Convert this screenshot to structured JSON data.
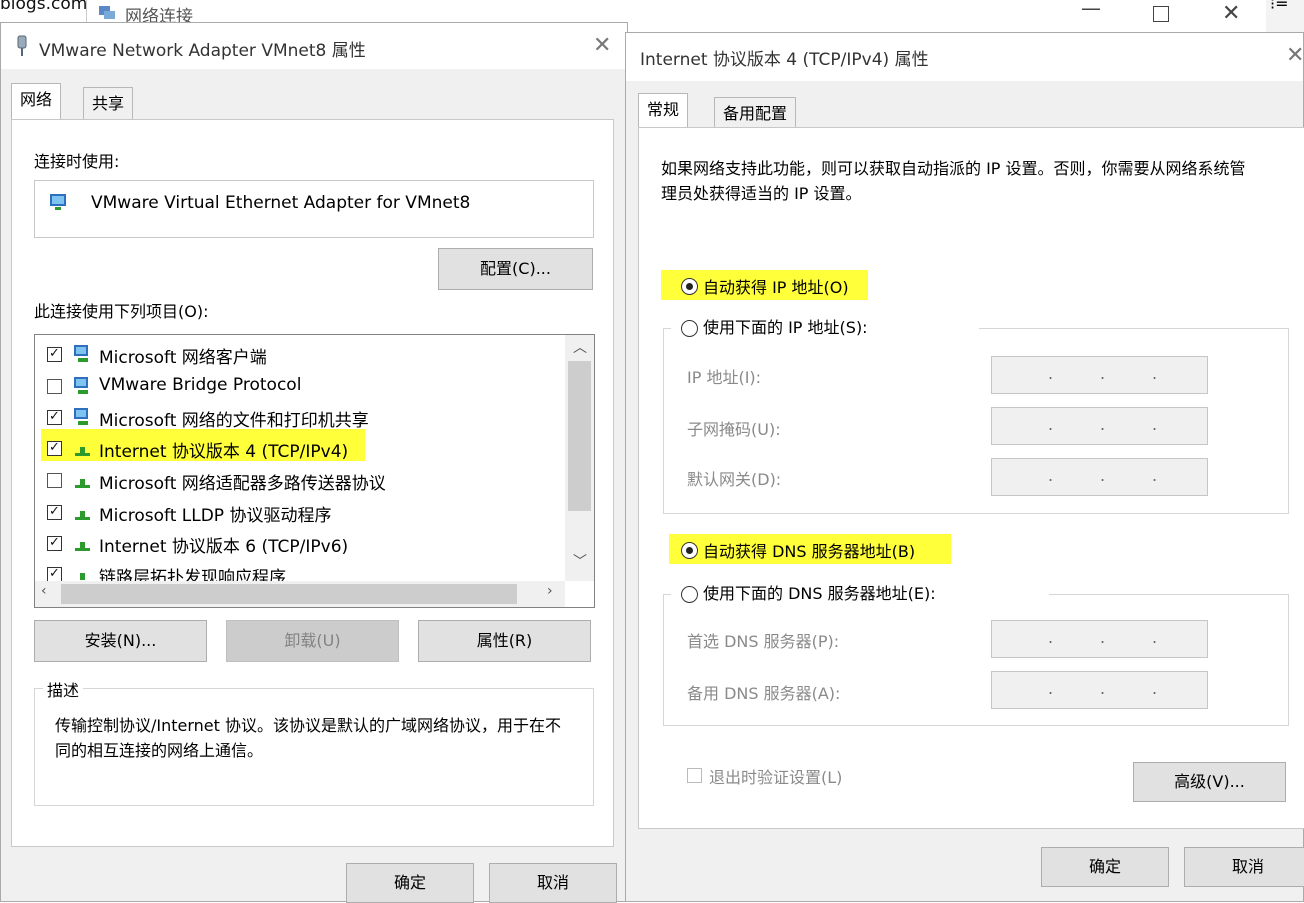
{
  "background": {
    "url_fragment": "blogs.com",
    "network_connections_title": "网络连接",
    "right_glyph": "⁝="
  },
  "adapter_dialog": {
    "title": "VMware Network Adapter VMnet8 属性",
    "tabs": [
      "网络",
      "共享"
    ],
    "connect_using_label": "连接时使用:",
    "adapter_name": "VMware Virtual Ethernet Adapter for VMnet8",
    "configure_button": "配置(C)...",
    "items_label": "此连接使用下列项目(O):",
    "items": [
      {
        "label": "Microsoft 网络客户端",
        "checked": true,
        "icon": "network-client-icon"
      },
      {
        "label": "VMware Bridge Protocol",
        "checked": false,
        "icon": "network-client-icon"
      },
      {
        "label": "Microsoft 网络的文件和打印机共享",
        "checked": true,
        "icon": "network-client-icon"
      },
      {
        "label": "Internet 协议版本 4 (TCP/IPv4)",
        "checked": true,
        "icon": "protocol-icon",
        "highlighted": true
      },
      {
        "label": "Microsoft 网络适配器多路传送器协议",
        "checked": false,
        "icon": "protocol-icon"
      },
      {
        "label": "Microsoft LLDP 协议驱动程序",
        "checked": true,
        "icon": "protocol-icon"
      },
      {
        "label": "Internet 协议版本 6 (TCP/IPv6)",
        "checked": true,
        "icon": "protocol-icon"
      },
      {
        "label": "链路层拓扑发现响应程序",
        "checked": true,
        "icon": "protocol-icon"
      }
    ],
    "install_button": "安装(N)...",
    "uninstall_button": "卸载(U)",
    "properties_button": "属性(R)",
    "description_title": "描述",
    "description_text": "传输控制协议/Internet 协议。该协议是默认的广域网络协议，用于在不同的相互连接的网络上通信。",
    "ok_button": "确定",
    "cancel_button": "取消"
  },
  "ipv4_dialog": {
    "title": "Internet 协议版本 4 (TCP/IPv4) 属性",
    "tabs": [
      "常规",
      "备用配置"
    ],
    "intro": "如果网络支持此功能，则可以获取自动指派的 IP 设置。否则，你需要从网络系统管理员处获得适当的 IP 设置。",
    "auto_ip_label": "自动获得 IP 地址(O)",
    "manual_ip_label": "使用下面的 IP 地址(S):",
    "ip_address_label": "IP 地址(I):",
    "subnet_label": "子网掩码(U):",
    "gateway_label": "默认网关(D):",
    "auto_dns_label": "自动获得 DNS 服务器地址(B)",
    "manual_dns_label": "使用下面的 DNS 服务器地址(E):",
    "preferred_dns_label": "首选 DNS 服务器(P):",
    "alternate_dns_label": "备用 DNS 服务器(A):",
    "validate_label": "退出时验证设置(L)",
    "advanced_button": "高级(V)...",
    "ok_button": "确定",
    "cancel_button": "取消",
    "ip_dot": "."
  },
  "colors": {
    "highlight": "#ffff3a",
    "dialog_bg": "#f0f0f0",
    "button_bg": "#e1e1e1"
  }
}
